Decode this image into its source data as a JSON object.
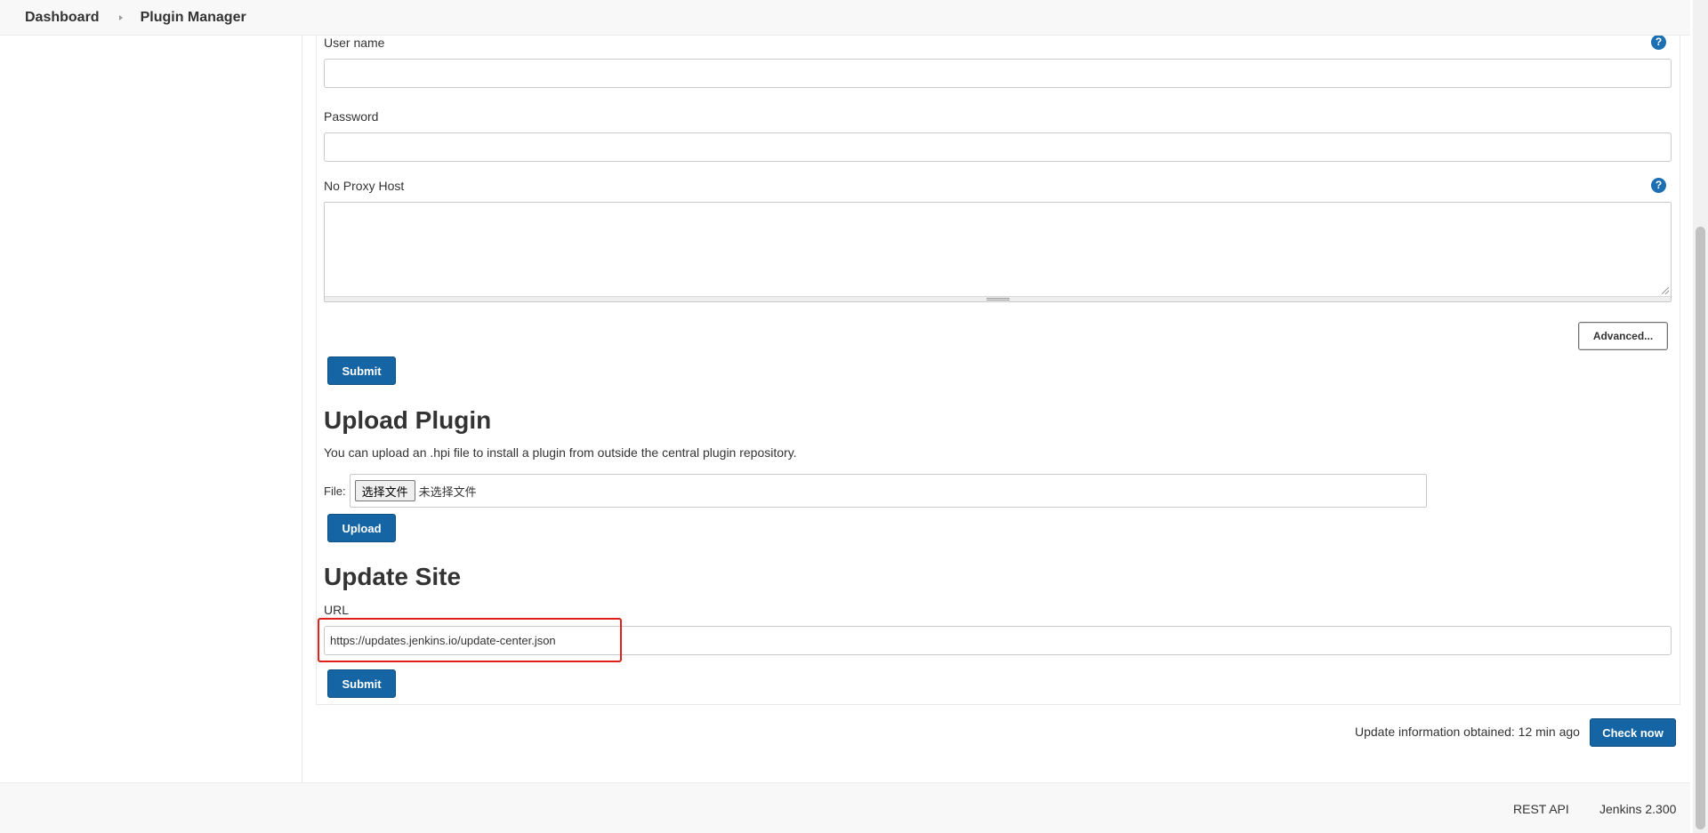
{
  "breadcrumb": {
    "items": [
      "Dashboard",
      "Plugin Manager"
    ]
  },
  "proxy": {
    "username_label": "User name",
    "username_value": "",
    "password_label": "Password",
    "password_value": "",
    "no_proxy_label": "No Proxy Host",
    "no_proxy_value": "",
    "help_glyph": "?",
    "advanced_label": "Advanced...",
    "submit_label": "Submit"
  },
  "upload": {
    "title": "Upload Plugin",
    "description": "You can upload an .hpi file to install a plugin from outside the central plugin repository.",
    "file_label": "File:",
    "choose_file_label": "选择文件",
    "no_file_text": "未选择文件",
    "upload_label": "Upload"
  },
  "update_site": {
    "title": "Update Site",
    "url_label": "URL",
    "url_value": "https://updates.jenkins.io/update-center.json",
    "submit_label": "Submit"
  },
  "status": {
    "info_text": "Update information obtained: 12 min ago",
    "check_now_label": "Check now"
  },
  "footer": {
    "rest_api": "REST API",
    "version": "Jenkins 2.300"
  },
  "colors": {
    "primary_button": "#1565a4",
    "help_icon": "#1d6fb3",
    "highlight": "#e0201b"
  }
}
